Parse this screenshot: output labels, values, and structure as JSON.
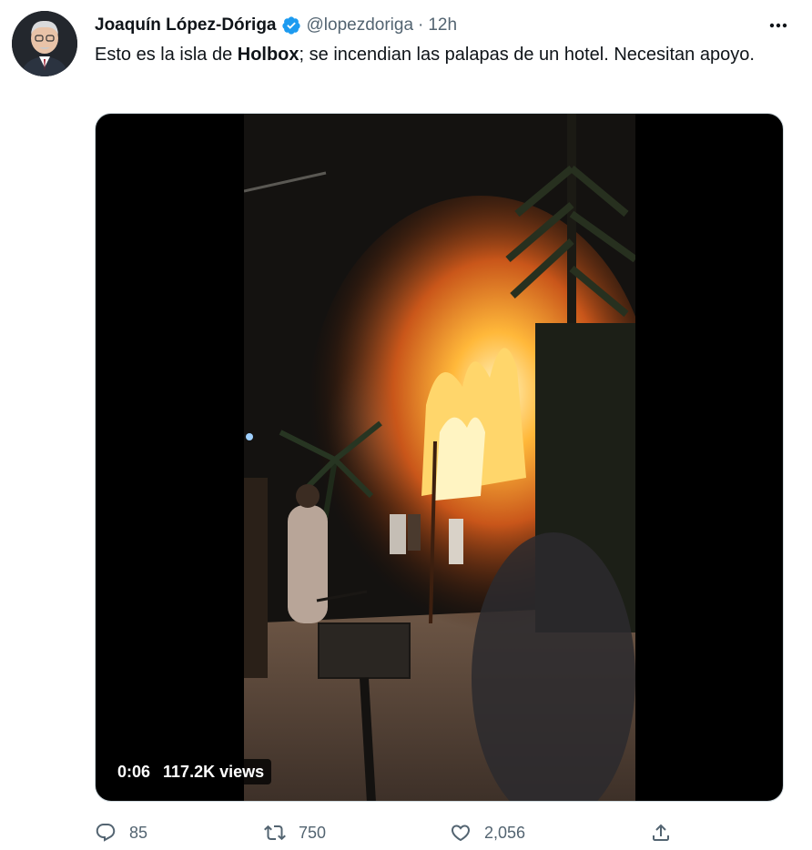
{
  "author": {
    "display_name": "Joaquín López-Dóriga",
    "handle": "@lopezdoriga",
    "time": "12h",
    "separator": "·"
  },
  "tweet": {
    "text_before": "Esto es la isla de ",
    "text_bold": "Holbox",
    "text_after": "; se incendian las palapas de un hotel. Necesitan apoyo."
  },
  "video": {
    "duration": "0:06",
    "views": "117.2K views"
  },
  "actions": {
    "reply_count": "85",
    "retweet_count": "750",
    "like_count": "2,056"
  },
  "icons": {
    "verified": "verified-badge-icon",
    "more": "more-dots-icon",
    "reply": "reply-icon",
    "retweet": "retweet-icon",
    "like": "heart-icon",
    "share": "share-icon"
  },
  "colors": {
    "text": "#0f1419",
    "secondary": "#536471",
    "verified_blue": "#1d9bf0"
  }
}
